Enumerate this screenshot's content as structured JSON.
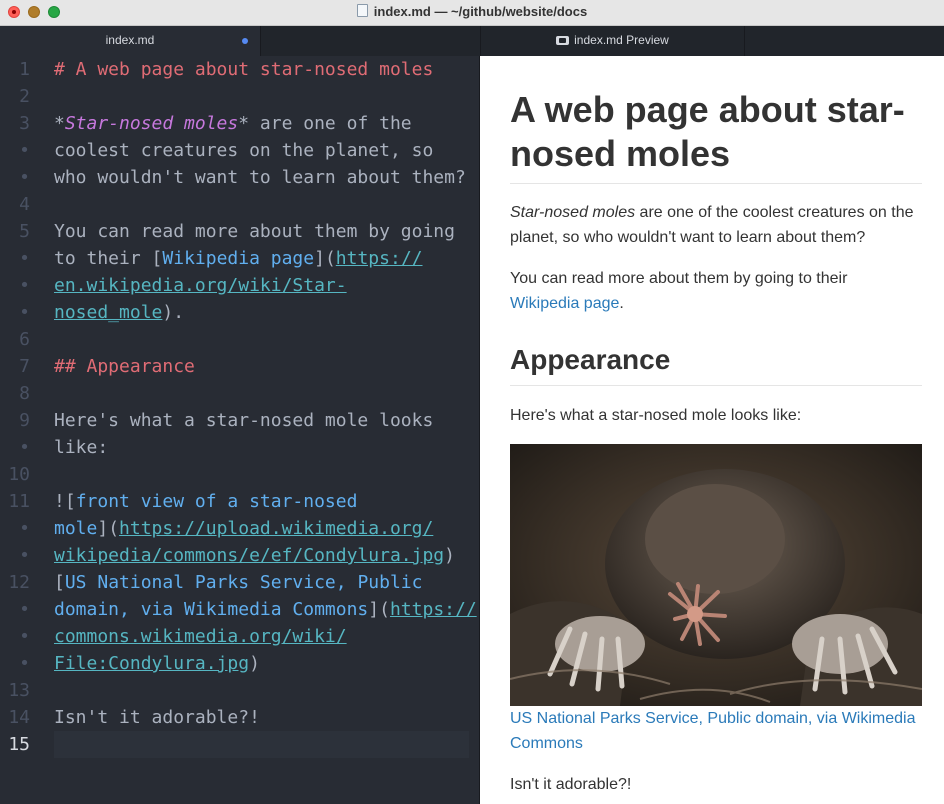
{
  "window": {
    "title": "index.md — ~/github/website/docs"
  },
  "tabs": {
    "editor": "index.md",
    "preview": "index.md Preview"
  },
  "editor": {
    "lines": [
      {
        "n": "1",
        "text": "# A web page about star-nosed moles"
      },
      {
        "n": "2",
        "text": ""
      },
      {
        "n": "3",
        "text": "*Star-nosed moles* are one of the coolest creatures on the planet, so who wouldn't want to learn about them?"
      },
      {
        "n": "4",
        "text": ""
      },
      {
        "n": "5",
        "text": "You can read more about them by going to their [Wikipedia page](https://en.wikipedia.org/wiki/Star-nosed_mole)."
      },
      {
        "n": "6",
        "text": ""
      },
      {
        "n": "7",
        "text": "## Appearance"
      },
      {
        "n": "8",
        "text": ""
      },
      {
        "n": "9",
        "text": "Here's what a star-nosed mole looks like:"
      },
      {
        "n": "10",
        "text": ""
      },
      {
        "n": "11",
        "text": "![front view of a star-nosed mole](https://upload.wikimedia.org/wikipedia/commons/e/ef/Condylura.jpg)"
      },
      {
        "n": "12",
        "text": "[US National Parks Service, Public domain, via Wikimedia Commons](https://commons.wikimedia.org/wiki/File:Condylura.jpg)"
      },
      {
        "n": "13",
        "text": ""
      },
      {
        "n": "14",
        "text": "Isn't it adorable?!"
      },
      {
        "n": "15",
        "text": ""
      }
    ],
    "fold_marker": "•"
  },
  "preview": {
    "h1_line1": "A web page about star-",
    "h1_line2": "nosed moles",
    "p1_em": "Star-nosed moles",
    "p1_line1_rest": " are one of the coolest creatures on the",
    "p1_line2": "planet, so who wouldn't want to learn about them?",
    "p2_line1": "You can read more about them by going to their",
    "p2_link": "Wikipedia page",
    "p2_end": ".",
    "h2": "Appearance",
    "p3": "Here's what a star-nosed mole looks like:",
    "image_alt": "front view of a star-nosed mole",
    "caption_line1": "US National Parks Service, Public domain, via Wikimedia",
    "caption_line2": "Commons",
    "p4": "Isn't it adorable?!"
  },
  "colors": {
    "editor_bg": "#282c34",
    "heading": "#e06c75",
    "emphasis": "#c678dd",
    "link_text": "#61afef",
    "link_url": "#56b6c2",
    "preview_link": "#2a7ab9"
  }
}
